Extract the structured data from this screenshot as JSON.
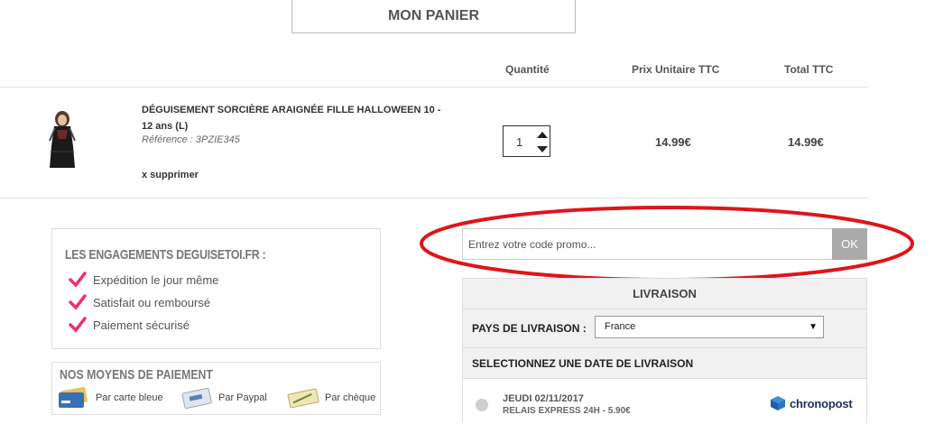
{
  "page_title": "MON PANIER",
  "table": {
    "headers": {
      "quantity": "Quantité",
      "unit_price": "Prix Unitaire TTC",
      "total": "Total TTC"
    }
  },
  "product": {
    "name": "DÉGUISEMENT SORCIÈRE ARAIGNÉE FILLE HALLOWEEN 10 - 12 ans (L)",
    "reference": "Référence : 3PZIE345",
    "remove_label": "x supprimer",
    "quantity": "1",
    "unit_price": "14.99€",
    "total": "14.99€"
  },
  "engagements": {
    "title": "LES ENGAGEMENTS DEGUISETOI.FR :",
    "items": [
      "Expédition le jour même",
      "Satisfait ou remboursé",
      "Paiement sécurisé"
    ]
  },
  "payment": {
    "title": "NOS MOYENS DE PAIEMENT",
    "methods": [
      {
        "label": "Par carte bleue",
        "icon": "credit-card-icon"
      },
      {
        "label": "Par Paypal",
        "icon": "paypal-card-icon"
      },
      {
        "label": "Par chèque",
        "icon": "cheque-icon"
      }
    ]
  },
  "promo": {
    "placeholder": "Entrez votre code promo...",
    "value": "",
    "button_label": "OK"
  },
  "delivery": {
    "title": "LIVRAISON",
    "country_label": "PAYS DE LIVRAISON :",
    "country_value": "France",
    "date_label": "SELECTIONNEZ UNE DATE DE LIVRAISON",
    "options": [
      {
        "date": "JEUDI 02/11/2017",
        "description": "RELAIS EXPRESS 24H - 5.90€",
        "carrier": "chronopost",
        "selected": false
      }
    ]
  },
  "colors": {
    "highlight_ellipse": "#e0141a",
    "button_grey": "#aaaaaa",
    "check_pink": "#e8336c",
    "chronopost_blue": "#1f2f5a"
  }
}
